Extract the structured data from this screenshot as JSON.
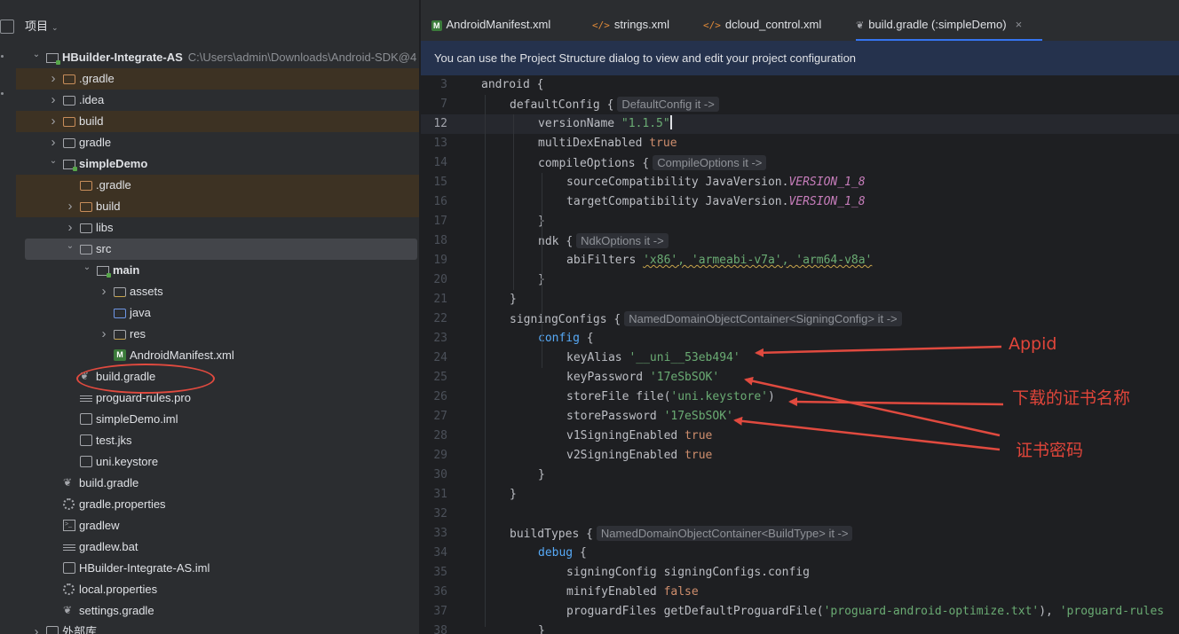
{
  "project_panel": {
    "title": "项目",
    "tree": [
      {
        "label": "HBuilder-Integrate-AS",
        "path": "C:\\Users\\admin\\Downloads\\Android-SDK@4",
        "depth": 0,
        "expanded": true,
        "icon": "module-folder-icon",
        "bold": true
      },
      {
        "label": ".gradle",
        "depth": 1,
        "expanded": false,
        "icon": "folder-orange-icon",
        "highlighted": true
      },
      {
        "label": ".idea",
        "depth": 1,
        "expanded": false,
        "icon": "folder-icon"
      },
      {
        "label": "build",
        "depth": 1,
        "expanded": false,
        "icon": "folder-orange-icon",
        "highlighted": true
      },
      {
        "label": "gradle",
        "depth": 1,
        "expanded": false,
        "icon": "folder-icon"
      },
      {
        "label": "simpleDemo",
        "depth": 1,
        "expanded": true,
        "icon": "module-folder-icon",
        "bold": true
      },
      {
        "label": ".gradle",
        "depth": 2,
        "icon": "folder-orange-icon",
        "highlighted": true
      },
      {
        "label": "build",
        "depth": 2,
        "expanded": false,
        "icon": "folder-orange-icon",
        "highlighted": true
      },
      {
        "label": "libs",
        "depth": 2,
        "expanded": false,
        "icon": "folder-icon"
      },
      {
        "label": "src",
        "depth": 2,
        "expanded": true,
        "icon": "folder-icon",
        "selected": true
      },
      {
        "label": "main",
        "depth": 3,
        "expanded": true,
        "icon": "module-folder-icon",
        "bold": true
      },
      {
        "label": "assets",
        "depth": 4,
        "expanded": false,
        "icon": "resource-folder-icon"
      },
      {
        "label": "java",
        "depth": 4,
        "icon": "folder-blue-icon"
      },
      {
        "label": "res",
        "depth": 4,
        "expanded": false,
        "icon": "resource-folder-icon"
      },
      {
        "label": "AndroidManifest.xml",
        "depth": 4,
        "icon": "xml-manifest-icon"
      },
      {
        "label": "build.gradle",
        "depth": 2,
        "icon": "gradle-icon",
        "circled": true
      },
      {
        "label": "proguard-rules.pro",
        "depth": 2,
        "icon": "text-file-icon"
      },
      {
        "label": "simpleDemo.iml",
        "depth": 2,
        "icon": "module-file-icon"
      },
      {
        "label": "test.jks",
        "depth": 2,
        "icon": "file-icon"
      },
      {
        "label": "uni.keystore",
        "depth": 2,
        "icon": "file-icon"
      },
      {
        "label": "build.gradle",
        "depth": 1,
        "icon": "gradle-icon"
      },
      {
        "label": "gradle.properties",
        "depth": 1,
        "icon": "gear-icon"
      },
      {
        "label": "gradlew",
        "depth": 1,
        "icon": "terminal-icon"
      },
      {
        "label": "gradlew.bat",
        "depth": 1,
        "icon": "text-file-icon"
      },
      {
        "label": "HBuilder-Integrate-AS.iml",
        "depth": 1,
        "icon": "module-file-icon"
      },
      {
        "label": "local.properties",
        "depth": 1,
        "icon": "gear-icon"
      },
      {
        "label": "settings.gradle",
        "depth": 1,
        "icon": "gradle-icon"
      },
      {
        "label": "外部库",
        "depth": 0,
        "expanded": false,
        "icon": "library-icon"
      }
    ]
  },
  "tabs": [
    {
      "label": "AndroidManifest.xml",
      "icon": "xml-manifest-icon",
      "active": false
    },
    {
      "label": "strings.xml",
      "icon": "xml-code-icon",
      "active": false
    },
    {
      "label": "dcloud_control.xml",
      "icon": "xml-code-icon",
      "active": false
    },
    {
      "label": "build.gradle (:simpleDemo)",
      "icon": "gradle-icon",
      "active": true
    }
  ],
  "banner": {
    "text": "You can use the Project Structure dialog to view and edit your project configuration"
  },
  "code_lines": [
    {
      "num": "3",
      "indent": 0,
      "tokens": [
        [
          "t",
          "android "
        ],
        [
          "b",
          "{"
        ]
      ]
    },
    {
      "num": "7",
      "indent": 1,
      "tokens": [
        [
          "t",
          "defaultConfig "
        ],
        [
          "b",
          "{"
        ],
        [
          "h",
          "DefaultConfig it ->"
        ]
      ]
    },
    {
      "num": "12",
      "indent": 2,
      "current": true,
      "tokens": [
        [
          "t",
          "versionName "
        ],
        [
          "s",
          "\"1.1.5\""
        ],
        [
          "caret",
          ""
        ]
      ]
    },
    {
      "num": "13",
      "indent": 2,
      "tokens": [
        [
          "t",
          "multiDexEnabled "
        ],
        [
          "k",
          "true"
        ]
      ]
    },
    {
      "num": "14",
      "indent": 2,
      "tokens": [
        [
          "t",
          "compileOptions "
        ],
        [
          "b",
          "{"
        ],
        [
          "h",
          "CompileOptions it ->"
        ]
      ]
    },
    {
      "num": "15",
      "indent": 3,
      "tokens": [
        [
          "t",
          "sourceCompatibility JavaVersion."
        ],
        [
          "c",
          "VERSION_1_8"
        ]
      ]
    },
    {
      "num": "16",
      "indent": 3,
      "tokens": [
        [
          "t",
          "targetCompatibility JavaVersion."
        ],
        [
          "c",
          "VERSION_1_8"
        ]
      ]
    },
    {
      "num": "17",
      "indent": 2,
      "tokens": [
        [
          "b",
          "}"
        ]
      ]
    },
    {
      "num": "18",
      "indent": 2,
      "tokens": [
        [
          "t",
          "ndk "
        ],
        [
          "b",
          "{"
        ],
        [
          "h",
          "NdkOptions it ->"
        ]
      ]
    },
    {
      "num": "19",
      "indent": 3,
      "tokens": [
        [
          "t",
          "abiFilters "
        ],
        [
          "sw",
          "'x86', 'armeabi-v7a', 'arm64-v8a'"
        ]
      ]
    },
    {
      "num": "20",
      "indent": 2,
      "tokens": [
        [
          "b",
          "}"
        ]
      ]
    },
    {
      "num": "21",
      "indent": 1,
      "tokens": [
        [
          "b",
          "}"
        ]
      ]
    },
    {
      "num": "22",
      "indent": 1,
      "tokens": [
        [
          "t",
          "signingConfigs "
        ],
        [
          "b",
          "{"
        ],
        [
          "h",
          "NamedDomainObjectContainer<SigningConfig> it ->"
        ]
      ]
    },
    {
      "num": "23",
      "indent": 2,
      "tokens": [
        [
          "k2",
          "config "
        ],
        [
          "b",
          "{"
        ]
      ]
    },
    {
      "num": "24",
      "indent": 3,
      "tokens": [
        [
          "t",
          "keyAlias "
        ],
        [
          "s",
          "'__uni__53eb494'"
        ]
      ]
    },
    {
      "num": "25",
      "indent": 3,
      "tokens": [
        [
          "t",
          "keyPassword "
        ],
        [
          "s",
          "'17eSbSOK'"
        ]
      ]
    },
    {
      "num": "26",
      "indent": 3,
      "tokens": [
        [
          "t",
          "storeFile file("
        ],
        [
          "s",
          "'uni.keystore'"
        ],
        [
          "t",
          ")"
        ]
      ]
    },
    {
      "num": "27",
      "indent": 3,
      "tokens": [
        [
          "t",
          "storePassword "
        ],
        [
          "s",
          "'17eSbSOK'"
        ]
      ]
    },
    {
      "num": "28",
      "indent": 3,
      "tokens": [
        [
          "t",
          "v1SigningEnabled "
        ],
        [
          "k",
          "true"
        ]
      ]
    },
    {
      "num": "29",
      "indent": 3,
      "tokens": [
        [
          "t",
          "v2SigningEnabled "
        ],
        [
          "k",
          "true"
        ]
      ]
    },
    {
      "num": "30",
      "indent": 2,
      "tokens": [
        [
          "b",
          "}"
        ]
      ]
    },
    {
      "num": "31",
      "indent": 1,
      "tokens": [
        [
          "b",
          "}"
        ]
      ]
    },
    {
      "num": "32",
      "indent": 0,
      "tokens": []
    },
    {
      "num": "33",
      "indent": 1,
      "tokens": [
        [
          "t",
          "buildTypes "
        ],
        [
          "b",
          "{"
        ],
        [
          "h",
          "NamedDomainObjectContainer<BuildType> it ->"
        ]
      ]
    },
    {
      "num": "34",
      "indent": 2,
      "tokens": [
        [
          "k2",
          "debug "
        ],
        [
          "b",
          "{"
        ]
      ]
    },
    {
      "num": "35",
      "indent": 3,
      "tokens": [
        [
          "t",
          "signingConfig signingConfigs.config"
        ]
      ]
    },
    {
      "num": "36",
      "indent": 3,
      "tokens": [
        [
          "t",
          "minifyEnabled "
        ],
        [
          "k",
          "false"
        ]
      ]
    },
    {
      "num": "37",
      "indent": 3,
      "tokens": [
        [
          "t",
          "proguardFiles getDefaultProguardFile("
        ],
        [
          "s",
          "'proguard-android-optimize.txt'"
        ],
        [
          "t",
          "), "
        ],
        [
          "s",
          "'proguard-rules"
        ]
      ]
    },
    {
      "num": "38",
      "indent": 2,
      "tokens": [
        [
          "b",
          "}"
        ]
      ]
    }
  ],
  "annotations": [
    {
      "text": "Appid"
    },
    {
      "text": "下载的证书名称"
    },
    {
      "text": "证书密码"
    }
  ],
  "colors": {
    "accent": "#3574f0",
    "annotation_red": "#e04a3f",
    "string_green": "#6aab73",
    "keyword_orange": "#cf8e6d",
    "constant_purple": "#c77dbb"
  }
}
